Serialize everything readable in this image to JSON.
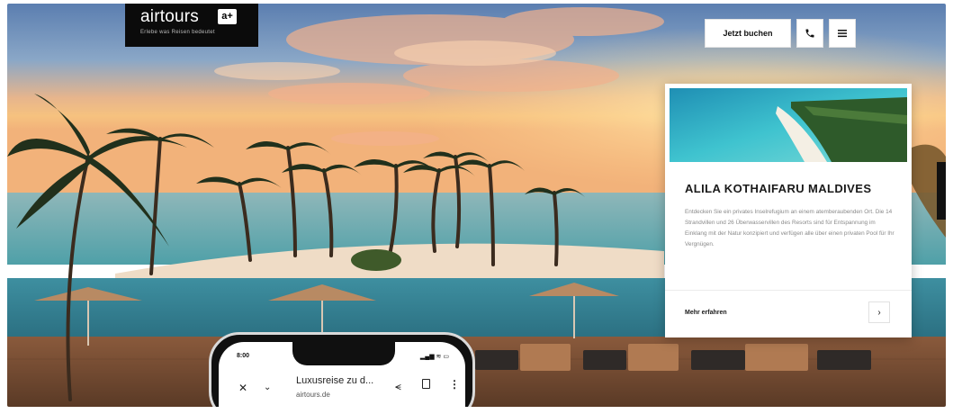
{
  "logo": {
    "word": "airtours",
    "mark": "a+",
    "tagline": "Erlebe was Reisen bedeutet"
  },
  "header": {
    "book_label": "Jetzt buchen",
    "phone_icon": "phone-icon",
    "menu_icon": "menu-icon"
  },
  "card": {
    "title": "ALILA KOTHAIFARU MALDIVES",
    "description": "Entdecken Sie ein privates Inselrefugium an einem atemberaubenden Ort. Die 14 Strandvillen und 26 Überwasservillen des Resorts sind für Entspannung im Einklang mit der Natur konzipiert und verfügen alle über einen privaten Pool für Ihr Vergnügen.",
    "link_label": "Mehr erfahren",
    "arrow": "›"
  },
  "phone": {
    "time": "8:00",
    "status": "▂▄▆ ≋ ▭",
    "close_glyph": "✕",
    "chevron_glyph": "⌄",
    "page_title": "Luxusreise zu d...",
    "domain": "airtours.de",
    "share_glyph": "⪪",
    "more_glyph": "⋮"
  },
  "colors": {
    "header_button_bg": "#ffffff",
    "logo_bg": "#0b0b0b",
    "card_text": "#1a1a1a"
  }
}
